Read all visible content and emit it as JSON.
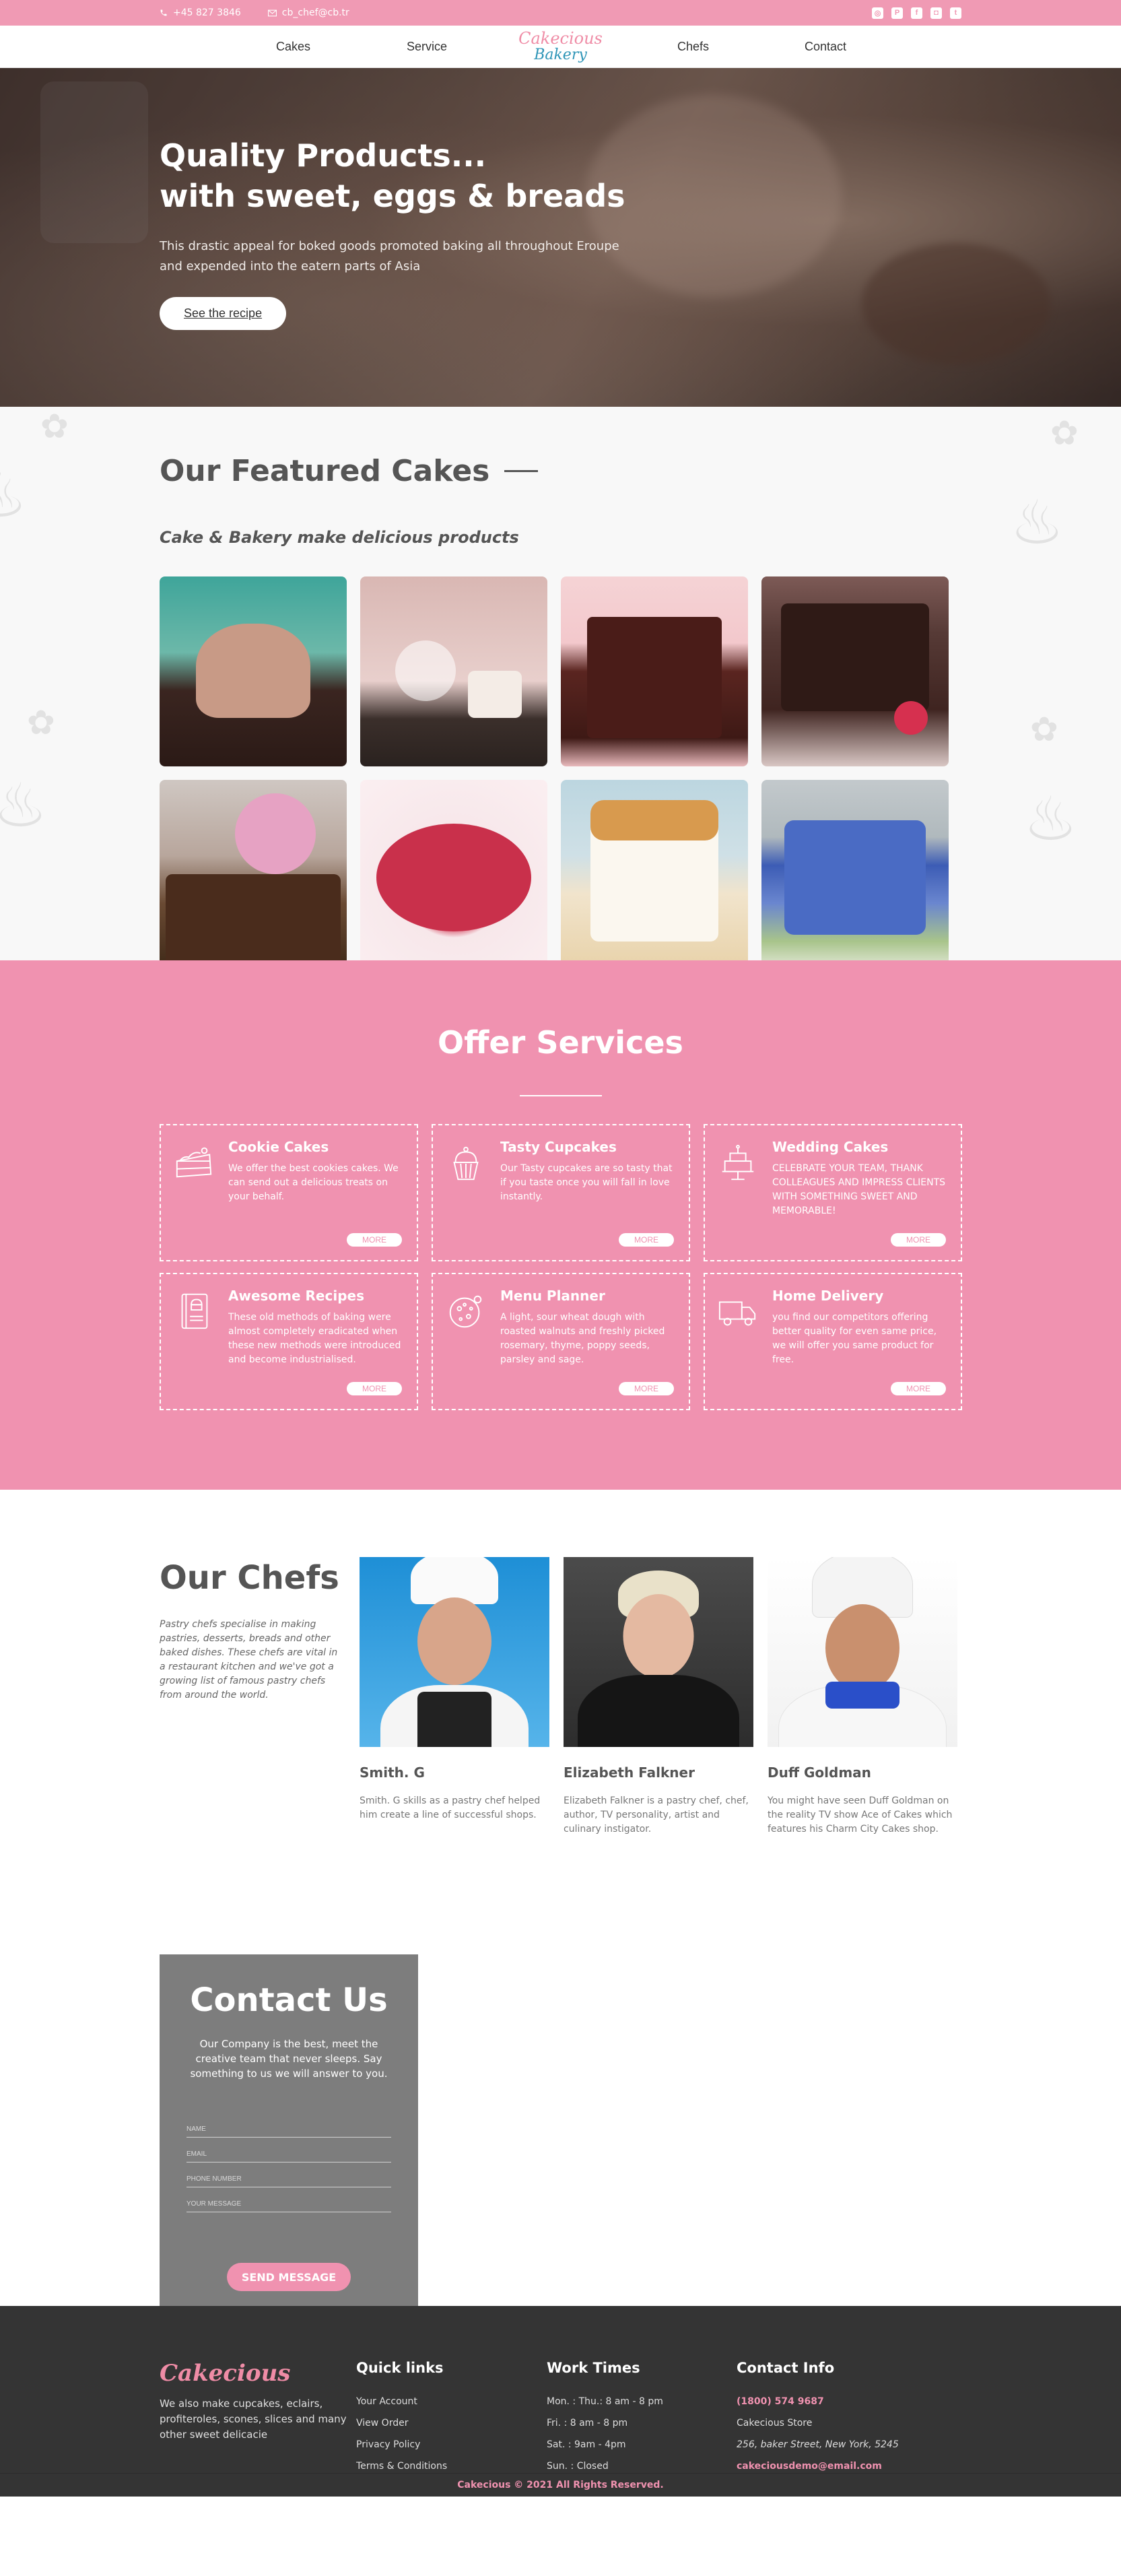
{
  "topbar": {
    "phone": "+45 827 3846",
    "email": "cb_chef@cb.tr",
    "socials": [
      "dribbble-icon",
      "pinterest-icon",
      "facebook-icon",
      "instagram-icon",
      "twitter-icon"
    ]
  },
  "nav": {
    "items": [
      "Cakes",
      "Service",
      "Chefs",
      "Contact"
    ],
    "logo_line1": "Cakecious",
    "logo_line2": "Bakery"
  },
  "hero": {
    "title_line1": "Quality Products...",
    "title_line2": "with sweet, eggs & breads",
    "text": "This drastic appeal for boked goods promoted baking all throughout Eroupe and expended into the eatern parts of Asia",
    "button": "See the recipe"
  },
  "featured": {
    "title": "Our Featured Cakes",
    "subtitle": "Cake & Bakery make delicious products"
  },
  "services": {
    "title": "Offer Services",
    "items": [
      {
        "title": "Cookie Cakes",
        "text": "We offer the best cookies cakes. We can send out a delicious treats on your behalf.",
        "more": "MORE",
        "icon": "cake-slice-icon"
      },
      {
        "title": "Tasty Cupcakes",
        "text": "Our Tasty cupcakes are so tasty that if you taste once you will fall in love instantly.",
        "more": "MORE",
        "icon": "cupcake-icon"
      },
      {
        "title": "Wedding Cakes",
        "text": "CELEBRATE YOUR TEAM, THANK COLLEAGUES AND IMPRESS CLIENTS WITH SOMETHING SWEET AND MEMORABLE!",
        "more": "MORE",
        "icon": "wedding-cake-icon"
      },
      {
        "title": "Awesome Recipes",
        "text": "These old methods of baking were almost completely eradicated when these new methods were introduced and become industrialised.",
        "more": "MORE",
        "icon": "recipe-book-icon"
      },
      {
        "title": "Menu Planner",
        "text": "A light, sour wheat dough with roasted walnuts and freshly picked rosemary, thyme, poppy seeds, parsley and sage.",
        "more": "MORE",
        "icon": "cookie-icon"
      },
      {
        "title": "Home Delivery",
        "text": "you find our competitors offering better quality for even same price, we will offer you same product for free.",
        "more": "MORE",
        "icon": "delivery-truck-icon"
      }
    ]
  },
  "chefs": {
    "title": "Our Chefs",
    "intro": "Pastry chefs specialise in making pastries, desserts, breads and other baked dishes. These chefs are vital in a restaurant kitchen and we've got a growing list of famous pastry chefs from around the world.",
    "list": [
      {
        "name": "Smith. G",
        "bio": "Smith. G skills as a pastry chef helped him create a line of successful shops."
      },
      {
        "name": "Elizabeth Falkner",
        "bio": "Elizabeth Falkner is a pastry chef, chef, author, TV personality, artist and culinary instigator."
      },
      {
        "name": "Duff Goldman",
        "bio": "You might have seen Duff Goldman on the reality TV show Ace of Cakes which features his Charm City Cakes shop."
      }
    ]
  },
  "contact": {
    "title": "Contact Us",
    "desc": "Our Company is the best, meet the creative team that never sleeps. Say something to us we will answer to you.",
    "fields": [
      "NAME",
      "EMAIL",
      "PHONE NUMBER",
      "YOUR MESSAGE"
    ],
    "button": "SEND MESSAGE"
  },
  "footer": {
    "brand": "Cakecious",
    "about": "We also make cupcakes, eclairs, profiteroles, scones, slices and many other sweet delicacie",
    "quick_title": "Quick links",
    "quick": [
      "Your Account",
      "View Order",
      "Privacy Policy",
      "Terms & Conditions"
    ],
    "work_title": "Work Times",
    "work": [
      "Mon. : Thu.: 8 am - 8 pm",
      "Fri. : 8 am - 8 pm",
      "Sat. : 9am - 4pm",
      "Sun. : Closed"
    ],
    "info_title": "Contact Info",
    "info_phone": "(1800) 574 9687",
    "info_store": "Cakecious Store",
    "info_address": "256, baker Street, New York, 5245",
    "info_email": "cakeciousdemo@email.com",
    "copyright": "Cakecious © 2021 All Rights Reserved."
  },
  "colors": {
    "accent": "#f092b0",
    "dark": "#343434",
    "logo_blue": "#2e95b7"
  }
}
